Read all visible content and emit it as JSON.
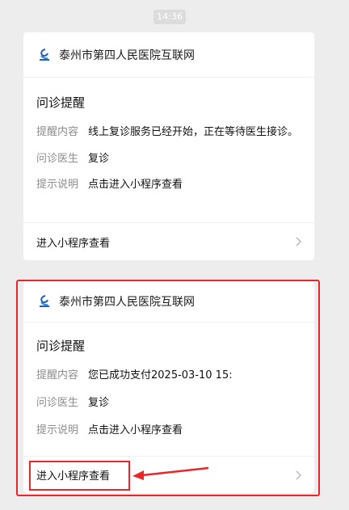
{
  "timestamp": "14:36",
  "cards": [
    {
      "account_name": "泰州市第四人民医院互联网",
      "title": "问诊提醒",
      "rows": [
        {
          "label": "提醒内容",
          "value": "线上复诊服务已经开始，正在等待医生接诊。"
        },
        {
          "label": "问诊医生",
          "value": "复诊"
        },
        {
          "label": "提示说明",
          "value": "点击进入小程序查看"
        }
      ],
      "footer_label": "进入小程序查看"
    },
    {
      "account_name": "泰州市第四人民医院互联网",
      "title": "问诊提醒",
      "rows": [
        {
          "label": "提醒内容",
          "value": "您已成功支付2025-03-10 15:"
        },
        {
          "label": "问诊医生",
          "value": "复诊"
        },
        {
          "label": "提示说明",
          "value": "点击进入小程序查看"
        }
      ],
      "footer_label": "进入小程序查看"
    }
  ],
  "colors": {
    "highlight": "#e8262b",
    "background": "#ededed"
  },
  "icons": {
    "logo": "hospital-logo-icon",
    "chevron": "chevron-right-icon"
  }
}
